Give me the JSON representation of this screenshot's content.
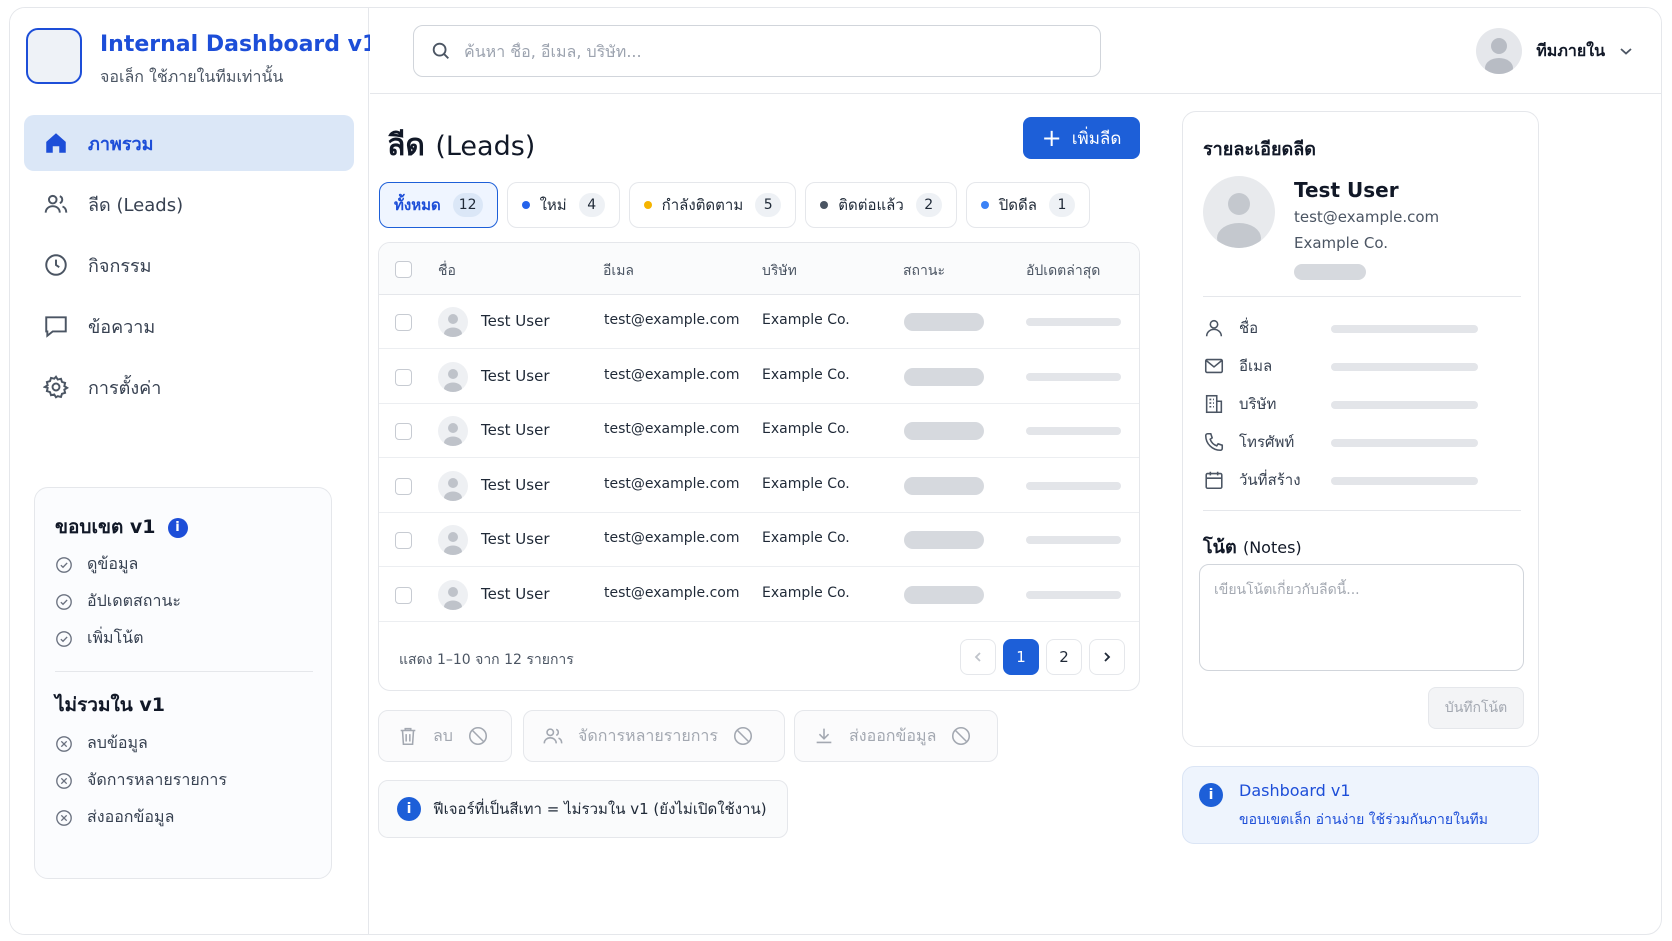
{
  "brand": {
    "title": "Internal Dashboard v1",
    "subtitle": "จอเล็ก ใช้ภายในทีมเท่านั้น"
  },
  "nav": [
    {
      "label": "ภาพรวม",
      "icon": "home-icon",
      "active": true
    },
    {
      "label": "ลีด (Leads)",
      "icon": "users-icon",
      "active": false
    },
    {
      "label": "กิจกรรม",
      "icon": "clock-icon",
      "active": false
    },
    {
      "label": "ข้อความ",
      "icon": "message-icon",
      "active": false
    },
    {
      "label": "การตั้งค่า",
      "icon": "gear-icon",
      "active": false
    }
  ],
  "scope": {
    "in_title": "ขอบเขต v1",
    "in_items": [
      "ดูข้อมูล",
      "อัปเดตสถานะ",
      "เพิ่มโน้ต"
    ],
    "out_title": "ไม่รวมใน v1",
    "out_items": [
      "ลบข้อมูล",
      "จัดการหลายรายการ",
      "ส่งออกข้อมูล"
    ]
  },
  "search": {
    "placeholder": "ค้นหา ชื่อ, อีเมล, บริษัท..."
  },
  "user": {
    "name": "ทีมภายใน"
  },
  "page": {
    "title": "ลีด",
    "title_en": "(Leads)",
    "add_button": "เพิ่มลีด"
  },
  "tabs": [
    {
      "label": "ทั้งหมด",
      "count": "12",
      "dot": null,
      "active": true
    },
    {
      "label": "ใหม่",
      "count": "4",
      "dot": "#2563eb",
      "active": false
    },
    {
      "label": "กำลังติดตาม",
      "count": "5",
      "dot": "#f5b400",
      "active": false
    },
    {
      "label": "ติดต่อแล้ว",
      "count": "2",
      "dot": "#4b5563",
      "active": false
    },
    {
      "label": "ปิดดีล",
      "count": "1",
      "dot": "#3b82f6",
      "active": false
    }
  ],
  "table": {
    "headers": {
      "name": "ชื่อ",
      "email": "อีเมล",
      "company": "บริษัท",
      "status": "สถานะ",
      "updated": "อัปเดตล่าสุด"
    },
    "rows": [
      {
        "name": "Test User",
        "email": "test@example.com",
        "company": "Example Co."
      },
      {
        "name": "Test User",
        "email": "test@example.com",
        "company": "Example Co."
      },
      {
        "name": "Test User",
        "email": "test@example.com",
        "company": "Example Co."
      },
      {
        "name": "Test User",
        "email": "test@example.com",
        "company": "Example Co."
      },
      {
        "name": "Test User",
        "email": "test@example.com",
        "company": "Example Co."
      },
      {
        "name": "Test User",
        "email": "test@example.com",
        "company": "Example Co."
      }
    ],
    "footer": "แสดง 1–10 จาก 12 รายการ",
    "pages": [
      "1",
      "2"
    ],
    "current_page": "1"
  },
  "bulk_actions": [
    {
      "label": "ลบ",
      "icon": "trash-icon"
    },
    {
      "label": "จัดการหลายรายการ",
      "icon": "users-icon"
    },
    {
      "label": "ส่งออกข้อมูล",
      "icon": "download-icon"
    }
  ],
  "legend_note": "ฟีเจอร์ที่เป็นสีเทา = ไม่รวมใน v1 (ยังไม่เปิดใช้งาน)",
  "detail": {
    "title": "รายละเอียดลีด",
    "name": "Test User",
    "email": "test@example.com",
    "company": "Example Co.",
    "fields": [
      {
        "label": "ชื่อ",
        "icon": "user-icon"
      },
      {
        "label": "อีเมล",
        "icon": "mail-icon"
      },
      {
        "label": "บริษัท",
        "icon": "building-icon"
      },
      {
        "label": "โทรศัพท์",
        "icon": "phone-icon"
      },
      {
        "label": "วันที่สร้าง",
        "icon": "calendar-icon"
      }
    ],
    "notes_title": "โน้ต",
    "notes_title_en": "(Notes)",
    "notes_placeholder": "เขียนโน้ตเกี่ยวกับลีดนี้...",
    "save_button": "บันทึกโน้ต"
  },
  "dash_note": {
    "title": "Dashboard v1",
    "text": "ขอบเขตเล็ก อ่านง่าย ใช้ร่วมกันภายในทีม"
  },
  "colors": {
    "accent": "#1d5fd8",
    "accent_text": "#1d4ed8",
    "active_nav_bg": "#dbe7f7",
    "disabled": "#a3a8b1"
  }
}
